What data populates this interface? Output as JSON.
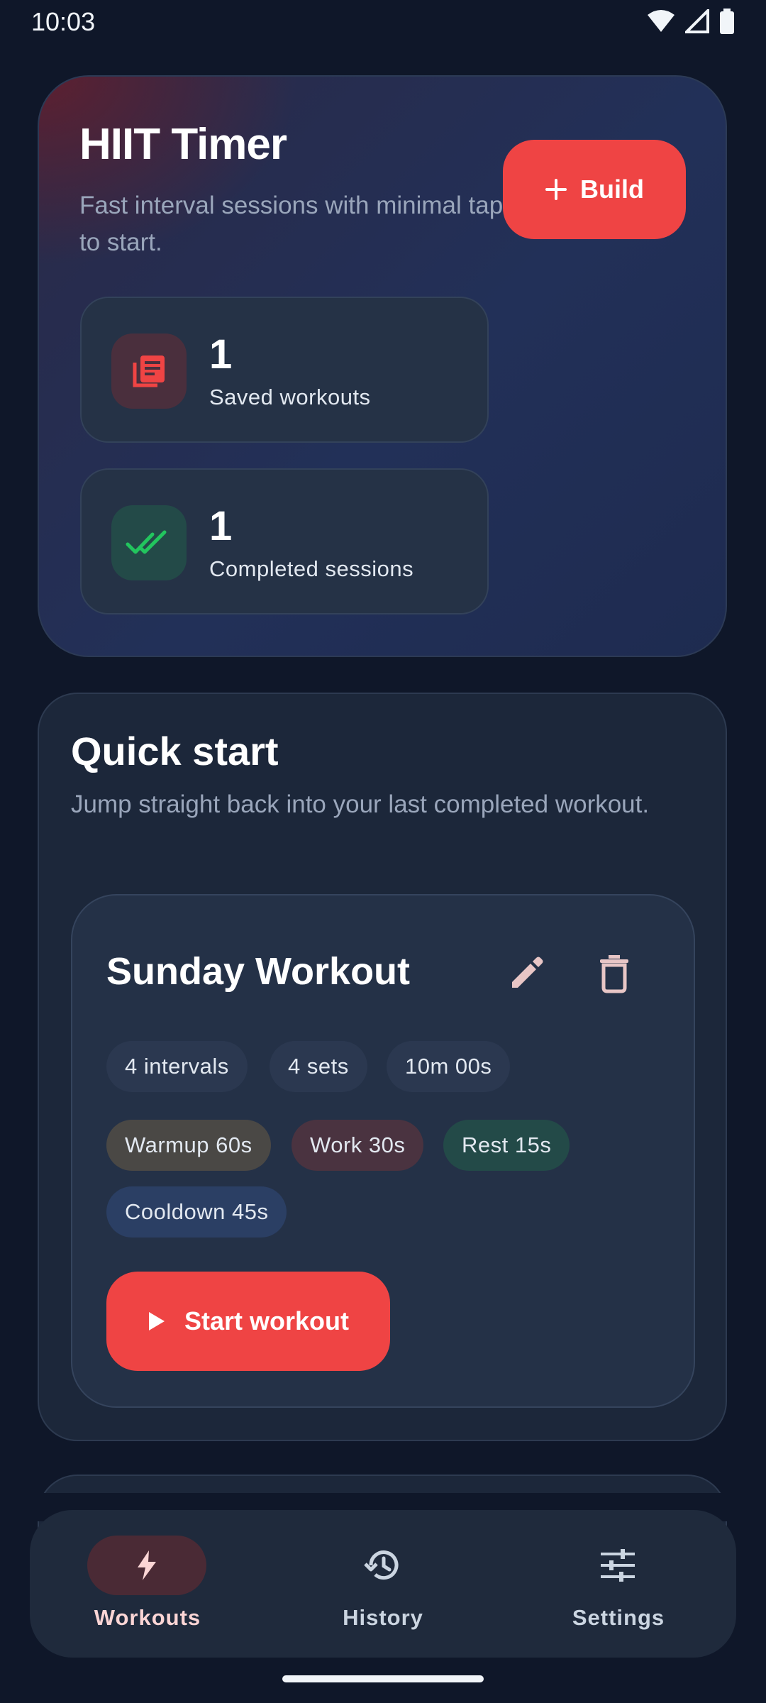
{
  "status_bar": {
    "time": "10:03"
  },
  "hero": {
    "title": "HIIT Timer",
    "subtitle": "Fast interval sessions with minimal taps to start.",
    "build_label": "Build",
    "stats": [
      {
        "value": "1",
        "label": "Saved workouts",
        "icon": "library-icon"
      },
      {
        "value": "1",
        "label": "Completed sessions",
        "icon": "double-check-icon"
      }
    ]
  },
  "quick_start": {
    "title": "Quick start",
    "subtitle": "Jump straight back into your last completed workout.",
    "workout": {
      "name": "Sunday Workout",
      "summary_chips": [
        "4 intervals",
        "4 sets",
        "10m 00s"
      ],
      "phase_chips": [
        {
          "label": "Warmup 60s",
          "color": "#4a4845"
        },
        {
          "label": "Work 30s",
          "color": "#4a3340"
        },
        {
          "label": "Rest 15s",
          "color": "#234a48"
        },
        {
          "label": "Cooldown 45s",
          "color": "#2b3f64"
        }
      ],
      "start_label": "Start workout"
    }
  },
  "nav": {
    "items": [
      {
        "label": "Workouts",
        "icon": "bolt-icon",
        "active": true
      },
      {
        "label": "History",
        "icon": "history-icon",
        "active": false
      },
      {
        "label": "Settings",
        "icon": "sliders-icon",
        "active": false
      }
    ]
  },
  "colors": {
    "accent": "#ef4444",
    "background": "#0f1729",
    "surface": "#1c273a",
    "nav_active_pill": "#4a2a35",
    "nav_active_text": "#fbd5d5"
  }
}
